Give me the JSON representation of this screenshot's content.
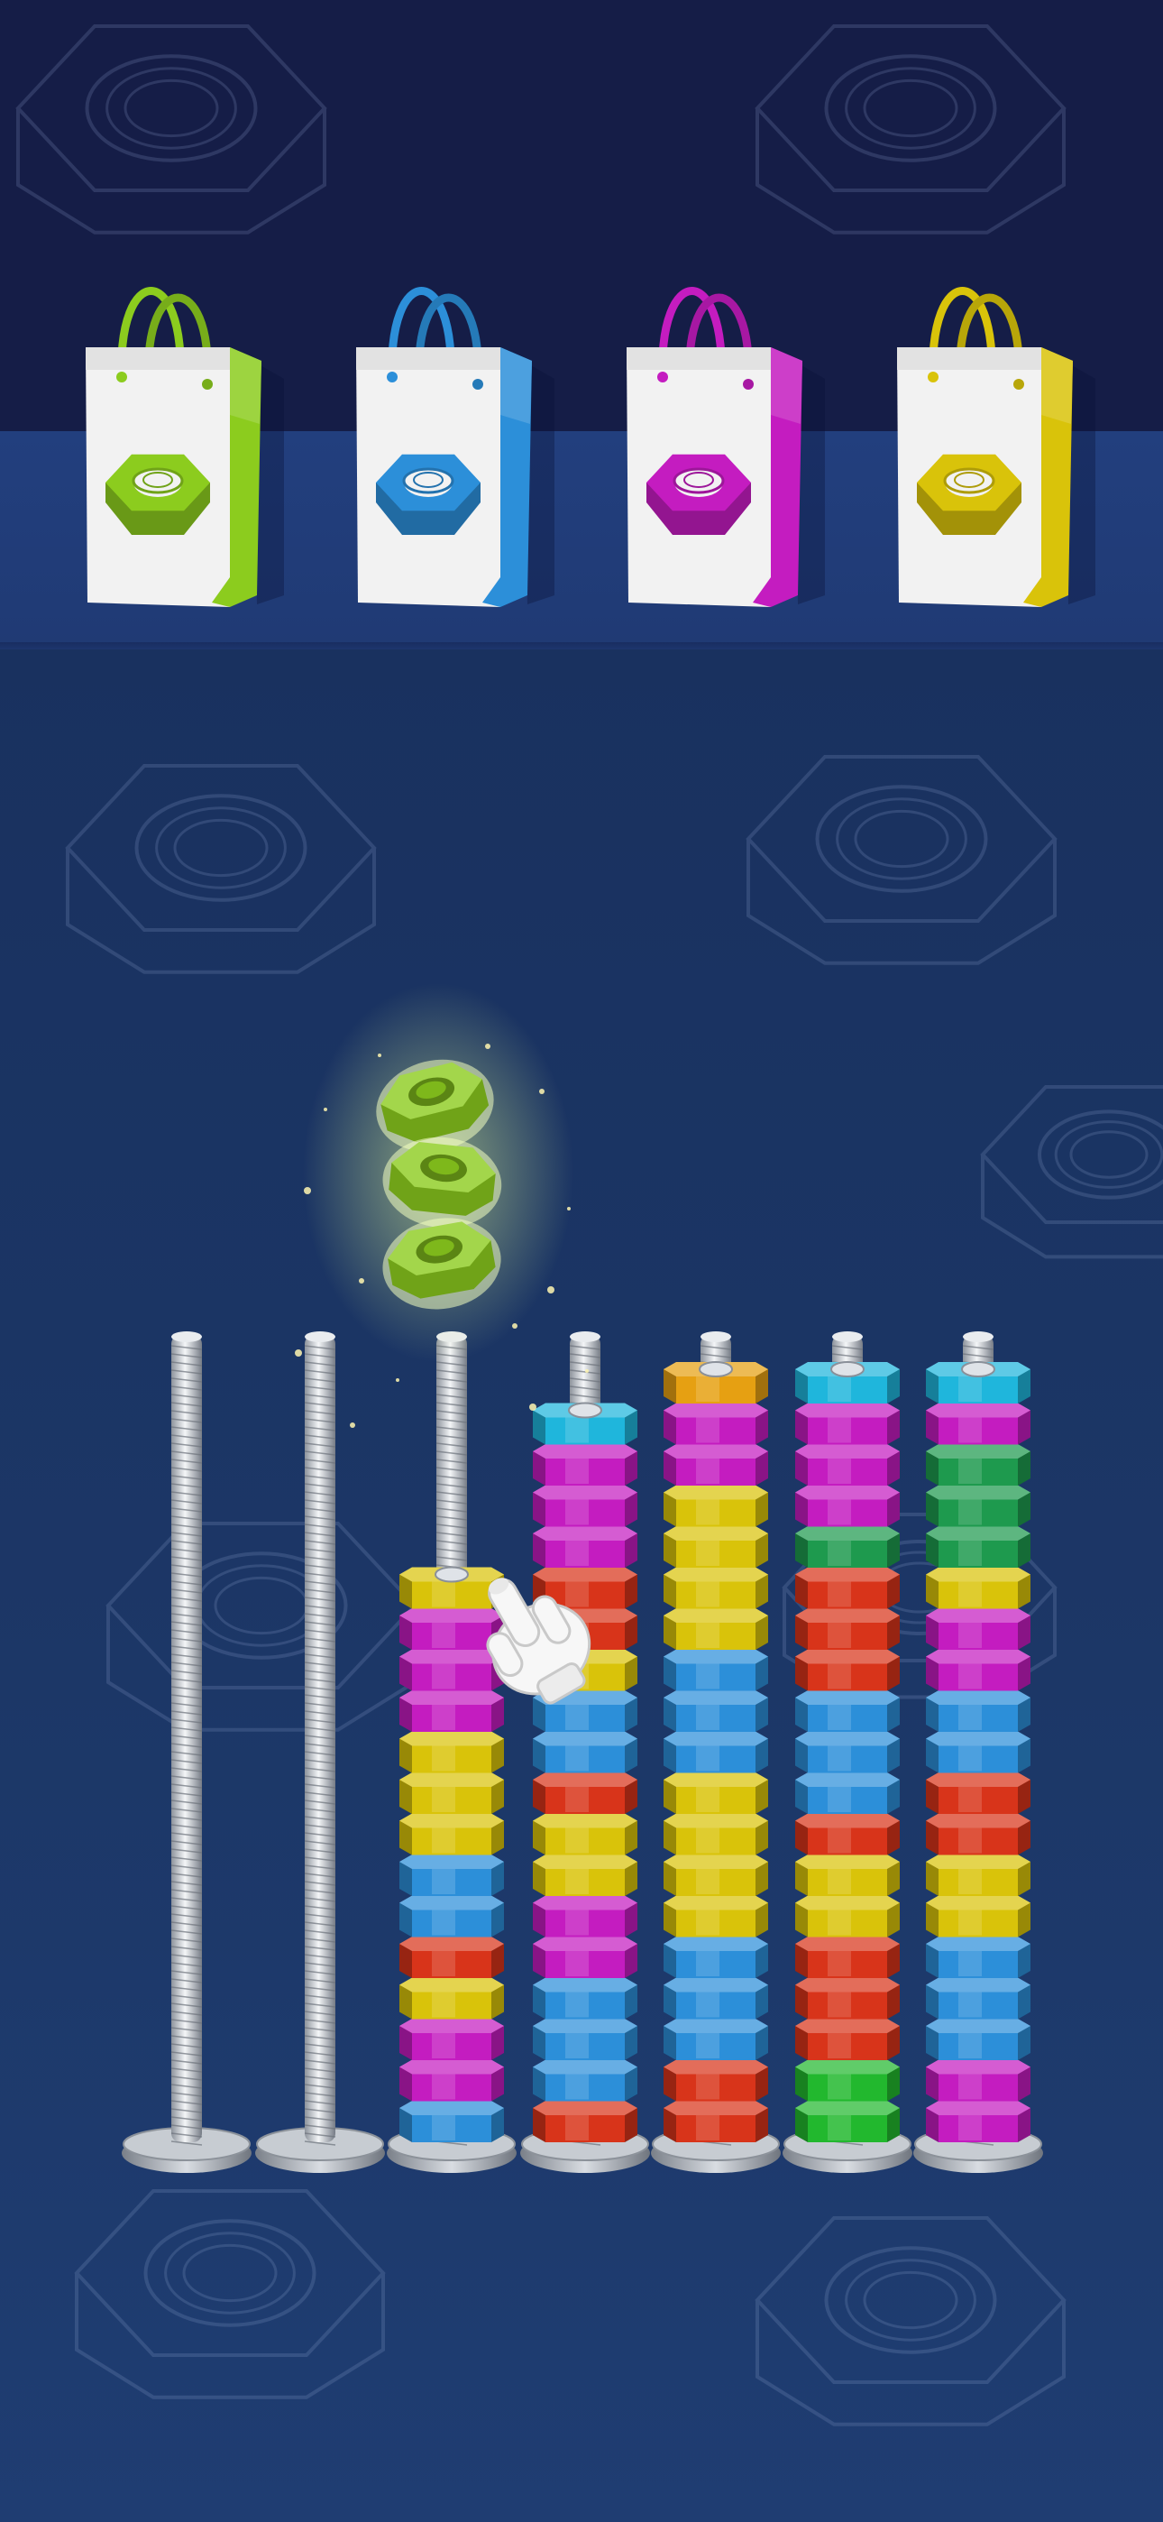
{
  "colors": {
    "green": "#8ccc1e",
    "blue": "#2c8fd9",
    "magenta": "#c41cc0",
    "yellow": "#d9c30a",
    "red": "#d8341a",
    "cyan": "#1fb6dc",
    "orange": "#e6a012",
    "dkgreen": "#1e9a4e",
    "brightgreen": "#22b82e"
  },
  "bags": [
    {
      "color": "green"
    },
    {
      "color": "blue"
    },
    {
      "color": "magenta"
    },
    {
      "color": "yellow"
    }
  ],
  "floating_nuts": {
    "color": "green",
    "count": 3,
    "above_bolt": 2
  },
  "bolts": [
    {
      "nuts": []
    },
    {
      "nuts": []
    },
    {
      "nuts": [
        "blue",
        "magenta",
        "magenta",
        "yellow",
        "red",
        "blue",
        "blue",
        "yellow",
        "yellow",
        "yellow",
        "magenta",
        "magenta",
        "magenta",
        "yellow"
      ]
    },
    {
      "nuts": [
        "red",
        "blue",
        "blue",
        "blue",
        "magenta",
        "magenta",
        "yellow",
        "yellow",
        "red",
        "blue",
        "blue",
        "yellow",
        "red",
        "red",
        "magenta",
        "magenta",
        "magenta",
        "cyan"
      ]
    },
    {
      "nuts": [
        "red",
        "red",
        "blue",
        "blue",
        "blue",
        "yellow",
        "yellow",
        "yellow",
        "yellow",
        "blue",
        "blue",
        "blue",
        "yellow",
        "yellow",
        "yellow",
        "yellow",
        "magenta",
        "magenta",
        "orange"
      ]
    },
    {
      "nuts": [
        "brightgreen",
        "brightgreen",
        "red",
        "red",
        "red",
        "yellow",
        "yellow",
        "red",
        "blue",
        "blue",
        "blue",
        "red",
        "red",
        "red",
        "dkgreen",
        "magenta",
        "magenta",
        "magenta",
        "cyan"
      ]
    },
    {
      "nuts": [
        "magenta",
        "magenta",
        "blue",
        "blue",
        "blue",
        "yellow",
        "yellow",
        "red",
        "red",
        "blue",
        "blue",
        "magenta",
        "magenta",
        "yellow",
        "dkgreen",
        "dkgreen",
        "dkgreen",
        "magenta",
        "cyan"
      ]
    }
  ],
  "hint": {
    "icon": "pointing-hand-icon",
    "target_bolt": 2
  }
}
